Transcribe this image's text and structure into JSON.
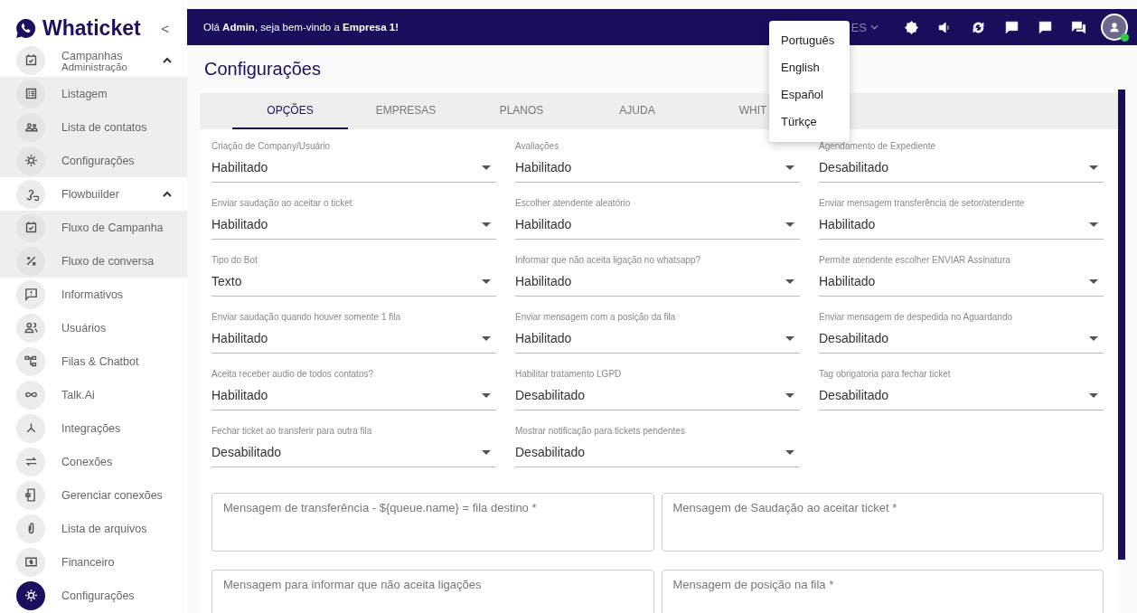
{
  "sidebar": {
    "brand": "Whaticket",
    "collapse": "<",
    "items": [
      {
        "label": "Campanhas",
        "sublabel": "Administração",
        "expanded": true,
        "selected": false,
        "children": [
          {
            "label": "Listagem",
            "selected": false
          },
          {
            "label": "Lista de contatos",
            "selected": false
          },
          {
            "label": "Configurações",
            "selected": false
          }
        ]
      },
      {
        "label": "Flowbuilder",
        "expanded": true,
        "selected": false,
        "children": [
          {
            "label": "Fluxo de Campanha",
            "selected": false
          },
          {
            "label": "Fluxo de conversa",
            "selected": false
          }
        ]
      },
      {
        "label": "Informativos",
        "selected": false
      },
      {
        "label": "Usuários",
        "selected": false
      },
      {
        "label": "Filas & Chatbot",
        "selected": false
      },
      {
        "label": "Talk.Ai",
        "selected": false
      },
      {
        "label": "Integrações",
        "selected": false
      },
      {
        "label": "Conexões",
        "selected": false
      },
      {
        "label": "Gerenciar conexões",
        "selected": false
      },
      {
        "label": "Lista de arquivos",
        "selected": false
      },
      {
        "label": "Financeiro",
        "selected": false
      },
      {
        "label": "Configurações",
        "selected": true
      }
    ]
  },
  "topbar": {
    "greeting": "Olá **Admin**, seja bem-vindo a **Empresa 1!**",
    "language": "ES",
    "user_online": true
  },
  "language_menu": [
    "Português",
    "English",
    "Español",
    "Türkçe"
  ],
  "page_title": "Configurações",
  "tabs": [
    {
      "label": "OPÇÕES",
      "selected": true
    },
    {
      "label": "EMPRESAS",
      "selected": false
    },
    {
      "label": "PLANOS",
      "selected": false
    },
    {
      "label": "AJUDA",
      "selected": false
    },
    {
      "label": "WHIT",
      "selected": false
    }
  ],
  "settings": [
    {
      "label": "Criação de Company/Usuário",
      "value": "Habilitado"
    },
    {
      "label": "Avaliações",
      "value": "Habilitado"
    },
    {
      "label": "Agendamento de Expediente",
      "value": "Desabilitado"
    },
    {
      "label": "Enviar saudação ao aceitar o ticket",
      "value": "Habilitado"
    },
    {
      "label": "Escolher atendente aleatório",
      "value": "Habilitado"
    },
    {
      "label": "Enviar mensagem transferência de setor/atendente",
      "value": "Habilitado"
    },
    {
      "label": "Tipo do Bot",
      "value": "Texto"
    },
    {
      "label": "Informar que não aceita ligação no whatsapp?",
      "value": "Habilitado"
    },
    {
      "label": "Permite atendente escolher ENVIAR Assinatura",
      "value": "Habilitado"
    },
    {
      "label": "Enviar saudação quando houver somente 1 fila",
      "value": "Habilitado"
    },
    {
      "label": "Enviar mensagem com a posição da fila",
      "value": "Habilitado"
    },
    {
      "label": "Enviar mensagem de despedida no Aguardando",
      "value": "Desabilitado"
    },
    {
      "label": "Aceita receber audio de todos contatos?",
      "value": "Habilitado"
    },
    {
      "label": "Habilitar tratamento LGPD",
      "value": "Desabilitado"
    },
    {
      "label": "Tag obrigatoria para fechar ticket",
      "value": "Desabilitado"
    },
    {
      "label": "Fechar ticket ao transferir para outra fila",
      "value": "Desabilitado"
    },
    {
      "label": "Mostrar notificação para tickets pendentes",
      "value": "Desabilitado"
    }
  ],
  "messages": [
    {
      "placeholder": "Mensagem de transferência - ${queue.name} = fila destino *"
    },
    {
      "placeholder": "Mensagem de Saudação ao aceitar ticket *"
    },
    {
      "placeholder": "Mensagem para informar que não aceita ligações"
    },
    {
      "placeholder": "Mensagem de posição na fila *"
    }
  ]
}
